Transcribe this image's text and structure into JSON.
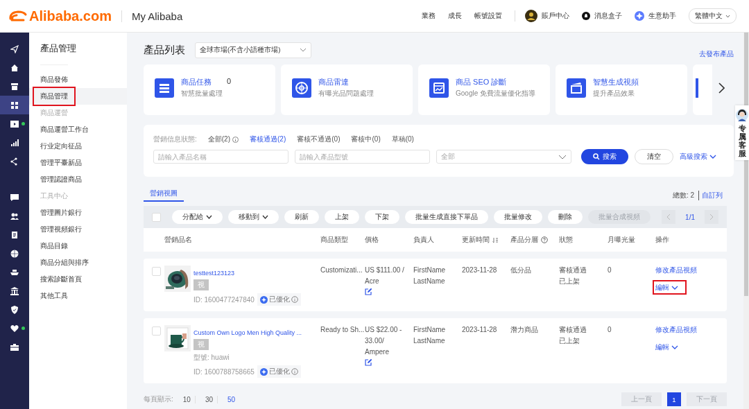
{
  "header": {
    "logo": "Alibaba.com",
    "subtitle": "My Alibaba",
    "nav": [
      "業務",
      "成長",
      "帳號設置"
    ],
    "account": "賬戶中心",
    "messages": "消息盒子",
    "assistant": "生意助手",
    "language": "繁體中文"
  },
  "rail": {
    "top": [
      {
        "kind": "send",
        "selected": false,
        "badge": false
      },
      {
        "kind": "home",
        "selected": false,
        "badge": false
      },
      {
        "kind": "store",
        "selected": false,
        "badge": false
      },
      {
        "kind": "grid",
        "selected": true,
        "badge": false
      },
      {
        "kind": "video",
        "selected": false,
        "badge": true
      },
      {
        "kind": "chart",
        "selected": false,
        "badge": false
      },
      {
        "kind": "share",
        "selected": false,
        "badge": false
      }
    ],
    "bottom": [
      {
        "kind": "chat",
        "selected": false,
        "badge": false
      },
      {
        "kind": "users",
        "selected": false,
        "badge": false
      },
      {
        "kind": "clipboard",
        "selected": false,
        "badge": false
      },
      {
        "kind": "globe",
        "selected": false,
        "badge": false
      },
      {
        "kind": "ship",
        "selected": false,
        "badge": false
      },
      {
        "kind": "bank",
        "selected": false,
        "badge": false
      },
      {
        "kind": "shield",
        "selected": false,
        "badge": false
      },
      {
        "kind": "heart",
        "selected": false,
        "badge": true
      },
      {
        "kind": "briefcase",
        "selected": false,
        "badge": false
      }
    ]
  },
  "sidebar": {
    "title": "產品管理",
    "groups": [
      {
        "items": [
          {
            "label": "商品發佈",
            "selected": false,
            "highlighted": false
          },
          {
            "label": "商品管理",
            "selected": true,
            "highlighted": true
          }
        ]
      },
      {
        "heading": "商品運營",
        "items": [
          {
            "label": "商品運營工作台",
            "selected": false,
            "highlighted": false
          },
          {
            "label": "行业定向征品",
            "selected": false,
            "highlighted": false
          },
          {
            "label": "管理平臺新品",
            "selected": false,
            "highlighted": false
          },
          {
            "label": "管理認證商品",
            "selected": false,
            "highlighted": false
          }
        ]
      },
      {
        "heading": "工具中心",
        "items": [
          {
            "label": "管理圖片銀行",
            "selected": false,
            "highlighted": false
          },
          {
            "label": "管理視頻銀行",
            "selected": false,
            "highlighted": false
          },
          {
            "label": "商品目錄",
            "selected": false,
            "highlighted": false
          },
          {
            "label": "商品分組與排序",
            "selected": false,
            "highlighted": false
          },
          {
            "label": "搜索診斷首頁",
            "selected": false,
            "highlighted": false
          },
          {
            "label": "其他工具",
            "selected": false,
            "highlighted": false
          }
        ]
      }
    ]
  },
  "page": {
    "title": "產品列表",
    "market": "全球市場(不含小語種市場)",
    "publish_link": "去發布產品"
  },
  "feature_cards": [
    {
      "kind": "task",
      "title": "商品任務",
      "count": "0",
      "subtitle": "智慧批量處理"
    },
    {
      "kind": "radar",
      "title": "商品雷達",
      "subtitle": "有曝光品問題處理"
    },
    {
      "kind": "seo",
      "title": "商品 SEO 診斷",
      "subtitle": "Google 免費流量優化指導"
    },
    {
      "kind": "video",
      "title": "智慧生成視頻",
      "subtitle": "提升產品效果"
    }
  ],
  "filter": {
    "label": "營銷信息狀態:",
    "tabs": [
      {
        "label": "全部(2)",
        "selected": false,
        "info": true
      },
      {
        "label": "審核通過(2)",
        "selected": true,
        "info": false
      },
      {
        "label": "審核不通過(0)",
        "selected": false,
        "info": false
      },
      {
        "label": "審核中(0)",
        "selected": false,
        "info": false
      },
      {
        "label": "草稿(0)",
        "selected": false,
        "info": false
      }
    ],
    "name_placeholder": "請輸入產品名稱",
    "model_placeholder": "請輸入產品型號",
    "category": "全部",
    "search": "搜索",
    "clear": "清空",
    "advanced": "高級搜索"
  },
  "views": [
    {
      "label": "營銷視圖",
      "selected": true
    }
  ],
  "total": "總數: 2",
  "customize": "自訂列",
  "select_all_checked": false,
  "toolbar": [
    {
      "label": "分配給",
      "dropdown": true,
      "disabled": false
    },
    {
      "label": "移動到",
      "dropdown": true,
      "disabled": false
    },
    {
      "label": "刷新",
      "dropdown": false,
      "disabled": false
    },
    {
      "label": "上架",
      "dropdown": false,
      "disabled": false
    },
    {
      "label": "下架",
      "dropdown": false,
      "disabled": false
    },
    {
      "label": "批量生成直接下單品",
      "dropdown": false,
      "disabled": false
    },
    {
      "label": "批量修改",
      "dropdown": false,
      "disabled": false
    },
    {
      "label": "刪除",
      "dropdown": false,
      "disabled": false
    },
    {
      "label": "批量合成視頻",
      "dropdown": false,
      "disabled": true
    }
  ],
  "top_pager": "1/1",
  "columns": [
    {
      "label": "營銷品名",
      "sortable": false,
      "help": false
    },
    {
      "label": "商品類型",
      "sortable": false,
      "help": false
    },
    {
      "label": "價格",
      "sortable": false,
      "help": false
    },
    {
      "label": "負責人",
      "sortable": false,
      "help": false
    },
    {
      "label": "更新時間",
      "sortable": true,
      "help": false
    },
    {
      "label": "產品分層",
      "sortable": false,
      "help": true
    },
    {
      "label": "狀態",
      "sortable": false,
      "help": false
    },
    {
      "label": "月曝光量",
      "sortable": false,
      "help": false
    },
    {
      "label": "操作",
      "sortable": false,
      "help": false
    }
  ],
  "rows": [
    {
      "checked": false,
      "name": "testtest123123",
      "tag": "視",
      "id": "ID: 1600477247840",
      "optimized": "已優化",
      "type": "Customizati...",
      "price": [
        "US $111.00 /",
        "Acre"
      ],
      "owner": [
        "FirstName",
        "LastName"
      ],
      "updated": "2023-11-28",
      "tier": "低分品",
      "status": [
        "審核通過",
        "已上架"
      ],
      "exposure": "0",
      "video_action": "修改產品視頻",
      "edit": "編輯",
      "edit_highlighted": true
    },
    {
      "checked": false,
      "name": "Custom Own Logo Men High Quality ...",
      "tag": "視",
      "model": "型號: huawi",
      "id": "ID: 1600788758665",
      "optimized": "已優化",
      "type": "Ready to Sh...",
      "price": [
        "US $22.00 -",
        "33.00/",
        "Ampere"
      ],
      "owner": [
        "FirstName",
        "LastName"
      ],
      "updated": "2023-11-28",
      "tier": "潛力商品",
      "status": [
        "審核通過",
        "已上架"
      ],
      "exposure": "0",
      "video_action": "修改產品視頻",
      "edit": "編輯",
      "edit_highlighted": false
    }
  ],
  "page_size": {
    "label": "每頁顯示:",
    "options": [
      {
        "label": "10",
        "selected": false
      },
      {
        "label": "30",
        "selected": false
      },
      {
        "label": "50",
        "selected": true
      }
    ]
  },
  "pagination": {
    "prev": "上一頁",
    "pages": [
      {
        "label": "1",
        "selected": true
      }
    ],
    "next": "下一頁",
    "prev_disabled": true,
    "next_disabled": true
  },
  "support": "专属客服"
}
